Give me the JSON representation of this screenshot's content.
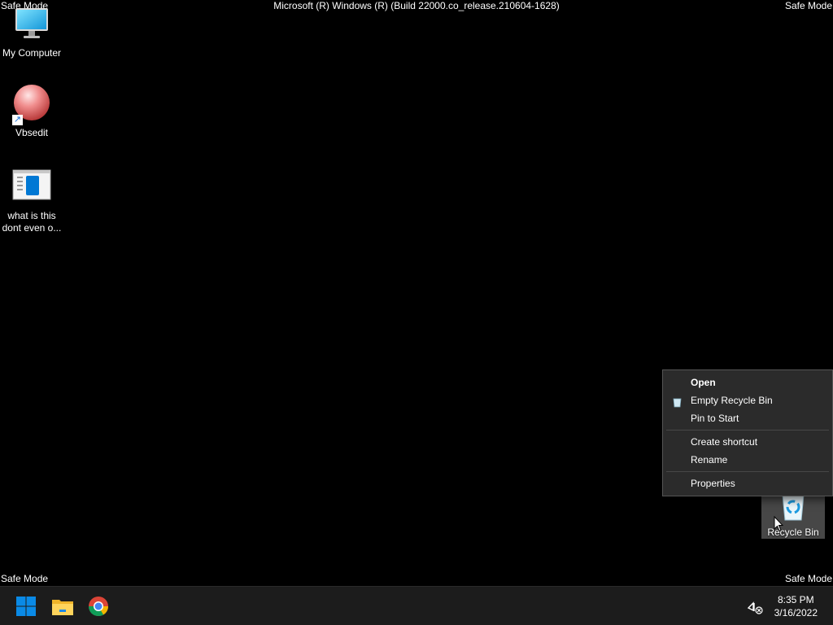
{
  "desktop": {
    "safe_mode_label": "Safe Mode",
    "build_label": "Microsoft (R) Windows (R) (Build 22000.co_release.210604-1628)",
    "icons": [
      {
        "label": "My Computer",
        "icon": "monitor-icon"
      },
      {
        "label": "Vbsedit",
        "icon": "vbsedit-ball-icon"
      },
      {
        "label": "what is this dont even o...",
        "icon": "document-icon"
      },
      {
        "label": "Recycle Bin",
        "icon": "recycle-bin-icon"
      }
    ]
  },
  "context_menu": {
    "items": [
      {
        "label": "Open",
        "bold": true
      },
      {
        "label": "Empty Recycle Bin",
        "icon": "recycle-bin-small-icon"
      },
      {
        "label": "Pin to Start"
      },
      {
        "label": "Create shortcut"
      },
      {
        "label": "Rename"
      },
      {
        "label": "Properties"
      }
    ]
  },
  "taskbar": {
    "apps": [
      {
        "name": "Start",
        "icon": "windows-logo-icon"
      },
      {
        "name": "File Explorer",
        "icon": "folder-icon"
      },
      {
        "name": "Google Chrome",
        "icon": "chrome-icon"
      }
    ],
    "tray": {
      "network_icon": "network-disconnected-icon"
    },
    "clock": {
      "time": "8:35 PM",
      "date": "3/16/2022"
    }
  },
  "colors": {
    "background": "#000000",
    "taskbar": "#1c1c1c",
    "menu": "#2b2b2b",
    "accent_blue": "#0078d4"
  }
}
